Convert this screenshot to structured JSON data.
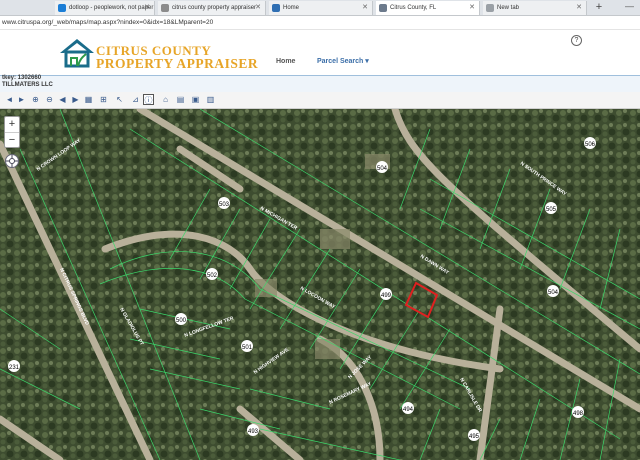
{
  "browser": {
    "tabs": [
      {
        "label": "dotloop - peoplework, not paper",
        "active": false,
        "color": "#1c7ed6"
      },
      {
        "label": "citrus county property appraiser",
        "active": false,
        "color": "#8c8c8c"
      },
      {
        "label": "Home",
        "active": false,
        "color": "#2f6fb3"
      },
      {
        "label": "Citrus County, FL",
        "active": true,
        "color": "#6c7a8c"
      },
      {
        "label": "New tab",
        "active": false,
        "color": "#9aa0a6"
      }
    ],
    "new_tab": "+",
    "window_controls": "—",
    "url": "www.citruspa.org/_web/maps/map.aspx?nindex=0&idx=18&LMparent=20"
  },
  "header": {
    "logo_line1": "CITRUS COUNTY",
    "logo_line2": "PROPERTY APPRAISER",
    "nav_home": "Home",
    "nav_parcel": "Parcel Search ▾",
    "help": "?"
  },
  "parcel_info": {
    "key": "tkey: 1302660",
    "owner": "TILLMATERS LLC"
  },
  "toolbar": {
    "tools": [
      "back-arrow-icon",
      "forward-arrow-icon",
      "pan-left-icon",
      "pan-right-icon",
      "layers-icon",
      "full-extent-icon",
      "zoom-in-icon",
      "zoom-out-icon",
      "select-arrow-icon",
      "measure-icon",
      "identify-icon",
      "info-icon",
      "buildings-icon",
      "print-icon",
      "export-icon",
      "legend-icon"
    ]
  },
  "map": {
    "zoom_in": "+",
    "zoom_out": "−",
    "street_labels": [
      "N CROWN LOOP WAY",
      "N DAWN WAY",
      "N SOUTH PRINCE WAY",
      "N MICHIGAN TER",
      "N GLADIOLUS PT",
      "N LONGFELLOW TER",
      "N HIGHVIEW AVE",
      "N JOSE WAY",
      "N LOCOON WAY",
      "N CITRUS SPRINGS BLVD",
      "N ROSEMARY WAY",
      "N CARLISLE DR"
    ],
    "lot_markers": [
      "504",
      "505",
      "506",
      "503",
      "502",
      "501",
      "500",
      "499",
      "498",
      "494",
      "493",
      "495",
      "230",
      "231"
    ],
    "highlighted_parcel_color": "#e02020"
  }
}
